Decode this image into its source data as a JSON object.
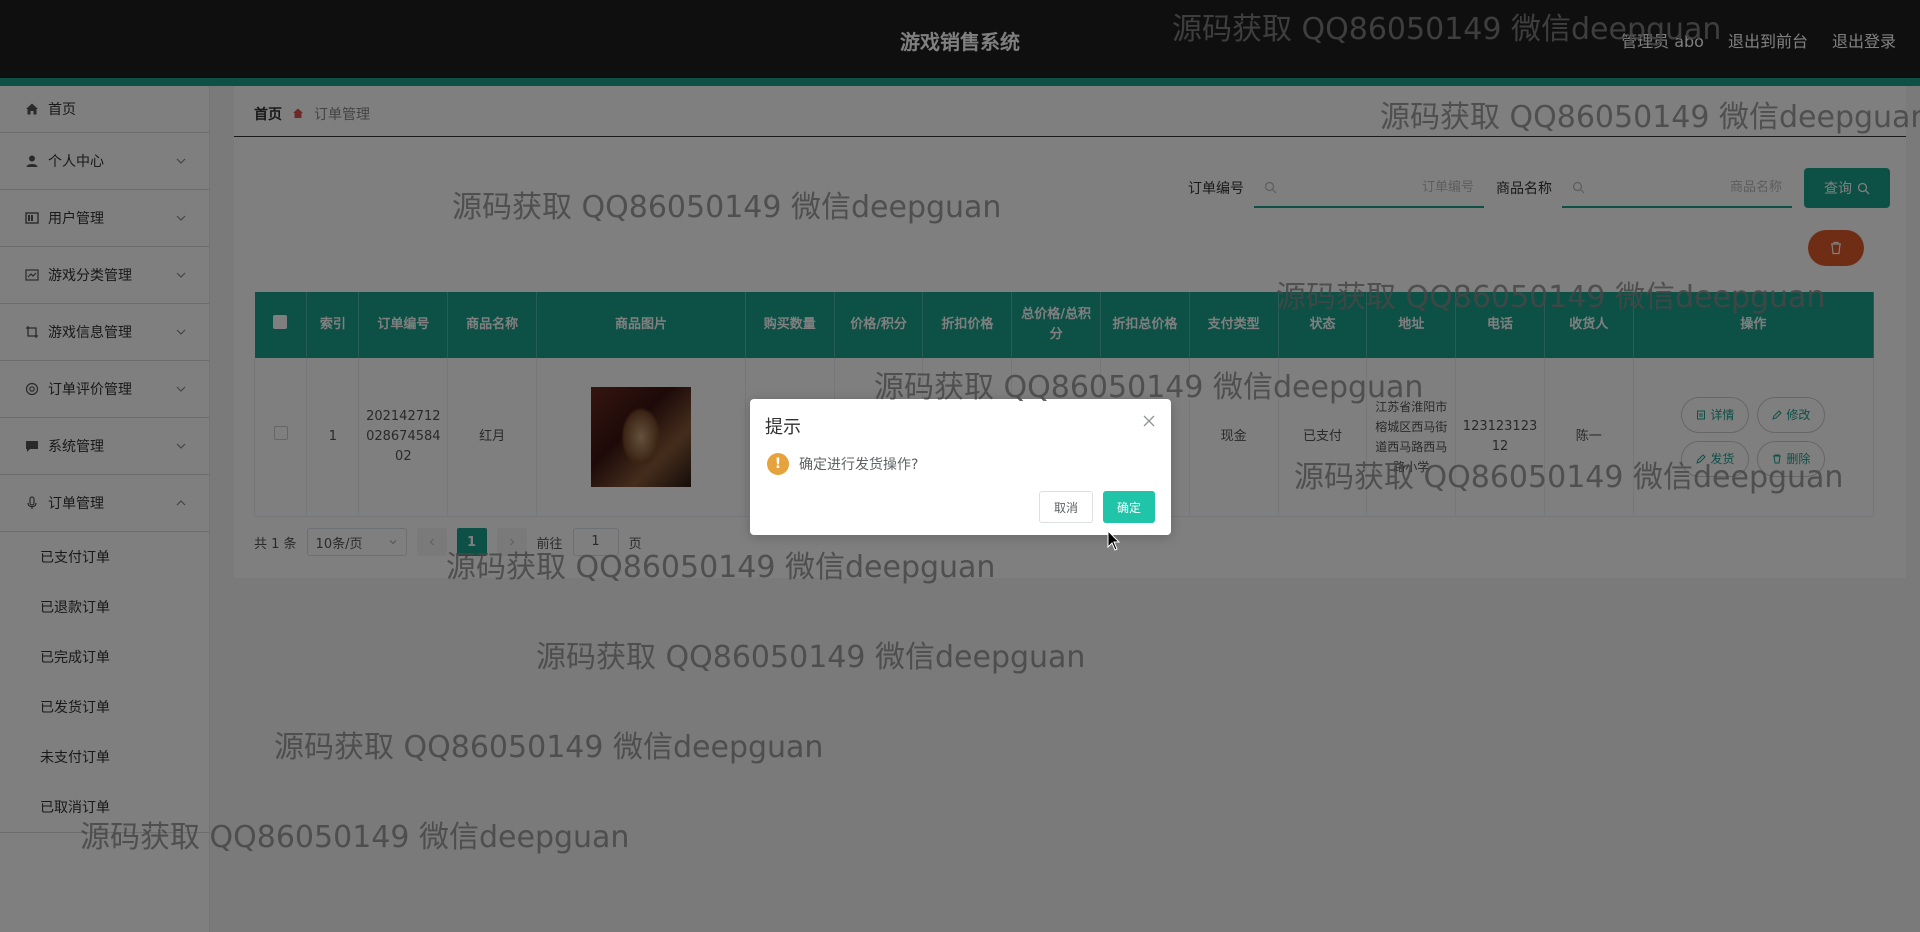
{
  "header": {
    "title": "游戏销售系统",
    "links": [
      "管理员 abo",
      "退出到前台",
      "退出登录"
    ]
  },
  "sidebar": {
    "items": [
      {
        "label": "首页",
        "icon": "home-icon"
      },
      {
        "label": "个人中心",
        "icon": "user-icon"
      },
      {
        "label": "用户管理",
        "icon": "users-icon"
      },
      {
        "label": "游戏分类管理",
        "icon": "category-icon"
      },
      {
        "label": "游戏信息管理",
        "icon": "crop-icon"
      },
      {
        "label": "订单评价管理",
        "icon": "gear-icon"
      },
      {
        "label": "系统管理",
        "icon": "chat-icon"
      },
      {
        "label": "订单管理",
        "icon": "mic-icon"
      }
    ],
    "submenu": [
      "已支付订单",
      "已退款订单",
      "已完成订单",
      "已发货订单",
      "未支付订单",
      "已取消订单"
    ]
  },
  "breadcrumb": {
    "home": "首页",
    "current": "订单管理"
  },
  "search": {
    "order_label": "订单编号",
    "order_placeholder": "订单编号",
    "product_label": "商品名称",
    "product_placeholder": "商品名称",
    "query_label": "查询"
  },
  "table": {
    "headers": [
      "索引",
      "订单编号",
      "商品名称",
      "商品图片",
      "购买数量",
      "价格/积分",
      "折扣价格",
      "总价格/总积分",
      "折扣总价格",
      "支付类型",
      "状态",
      "地址",
      "电话",
      "收货人",
      "操作"
    ],
    "row": {
      "index": "1",
      "order_no": "20214271202867458402",
      "product": "红月",
      "pay_type": "现金",
      "status": "已支付",
      "address": "江苏省淮阳市榕城区西马街道西马路西马路小学",
      "phone": "12312312312",
      "receiver": "陈一",
      "ops": [
        "详情",
        "修改",
        "发货",
        "删除"
      ]
    }
  },
  "pagination": {
    "total": "共 1 条",
    "page_size": "10条/页",
    "current_page": "1",
    "goto_label": "前往",
    "goto_value": "1",
    "page_unit": "页"
  },
  "dialog": {
    "title": "提示",
    "message": "确定进行发货操作?",
    "cancel": "取消",
    "confirm": "确定"
  },
  "watermark": {
    "text": "源码获取 QQ86050149 微信deepguan"
  },
  "colors": {
    "accent": "#1aa08c",
    "topbar": "#1e1e1e",
    "danger": "#e05a2a",
    "warning": "#e6a23c"
  }
}
